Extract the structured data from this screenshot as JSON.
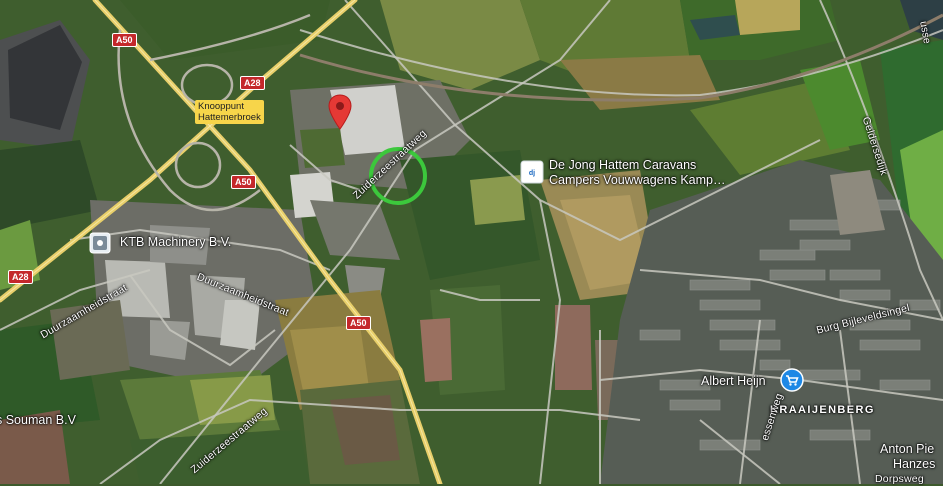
{
  "map": {
    "poi": {
      "ktb": "KTB Machinery B.V.",
      "dejong_line1": "De Jong Hattem Caravans",
      "dejong_line2": "Campers Vouwwagens Kamp…",
      "souman": "s Souman B.V",
      "albert_heijn": "Albert Heijn",
      "anton_line1": "Anton Pie",
      "anton_line2": "Hanzes"
    },
    "junction": {
      "line1": "Knooppunt",
      "line2": "Hattemerbroek"
    },
    "shields": {
      "a50_top": "A50",
      "a28_top": "A28",
      "a50_mid": "A50",
      "a28_left": "A28",
      "a50_bottom": "A50"
    },
    "roads": {
      "zuiderzee_north": "Zuiderzeestraatweg",
      "zuiderzee_south": "Zuiderzeestraatweg",
      "duurzaam_left": "Duurzaamheidstraat",
      "duurzaam_right": "Duurzaamheidstraat",
      "geldersedijk": "Geldersedijk",
      "bijleveldsingel": "Burg Bijleveldsingel",
      "essenweg": "essenweg",
      "dorpsweg": "Dorpsweg",
      "edge_top_right": "usse"
    },
    "neighbourhood": "KRAAIJENBERG",
    "colors": {
      "pin": "#e53935",
      "marker_ring": "#3cc83c",
      "motorway": "#e8cf6a",
      "shield": "#c4282b",
      "junction_label": "#f7d54a",
      "shopping_icon": "#1e88e5"
    },
    "icons": [
      "map-pin-icon",
      "place-icon",
      "caravan-logo-icon",
      "shopping-cart-icon"
    ]
  }
}
